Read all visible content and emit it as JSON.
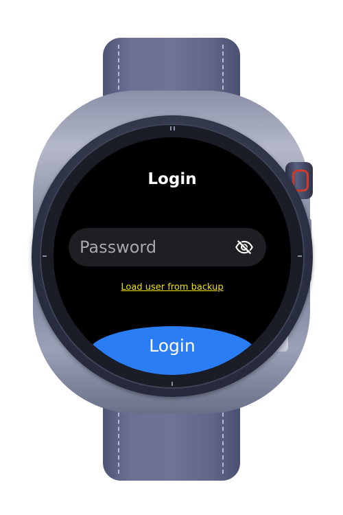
{
  "screen": {
    "title": "Login",
    "password": {
      "placeholder": "Password",
      "value": "",
      "toggle_icon": "eye-off-icon"
    },
    "backup_link_label": "Load user from backup",
    "login_button_label": "Login"
  },
  "colors": {
    "screen_background": "#000000",
    "input_background": "#1e1f23",
    "link": "#f0e30e",
    "primary_button": "#2a7df2",
    "crown_accent": "#d23b2a"
  }
}
